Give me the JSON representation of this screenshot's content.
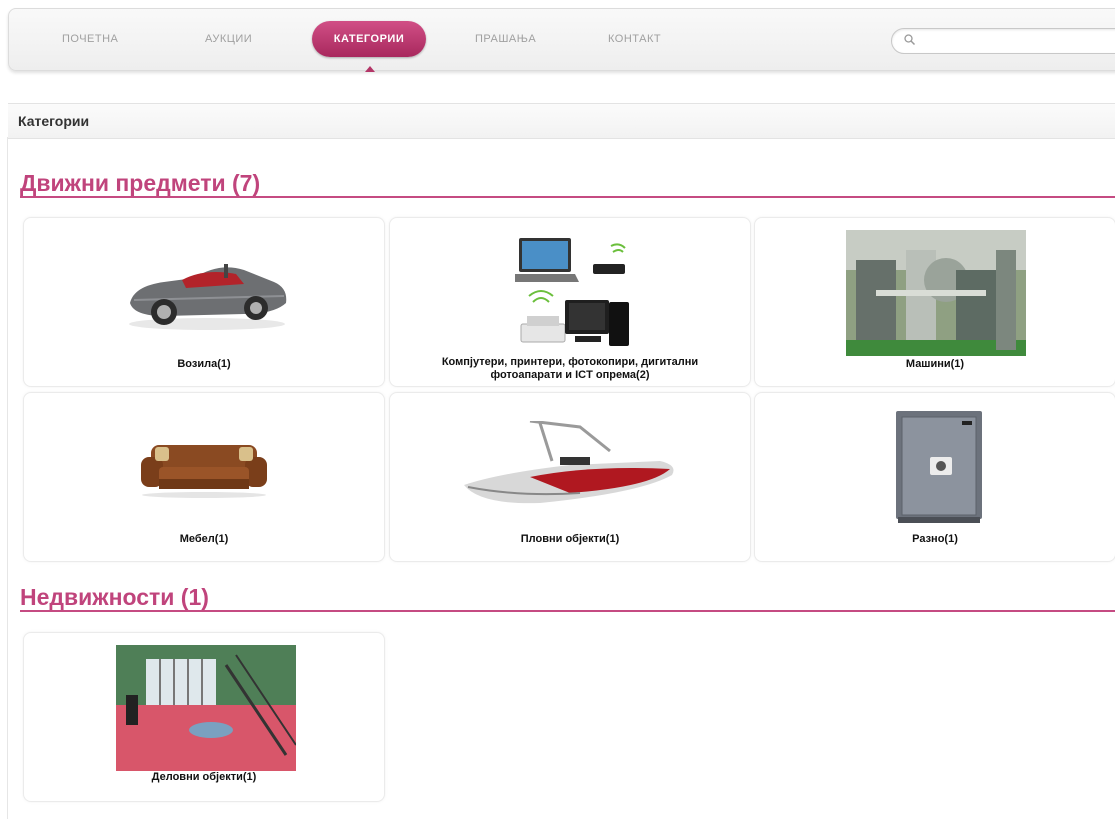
{
  "nav": {
    "items": [
      "ПОЧЕТНА",
      "АУКЦИИ",
      "КАТЕГОРИИ",
      "ПРАШАЊА",
      "КОНТАКТ"
    ],
    "active": "КАТЕГОРИИ",
    "search_placeholder": ""
  },
  "breadcrumb": {
    "title": "Категории"
  },
  "sections": [
    {
      "title": "Движни предмети (7)",
      "cards": [
        {
          "label": "Возила(1)",
          "icon": "car-image"
        },
        {
          "label": "Компјутери, принтери, фотокопири, дигитални фотоапарати и ICT опрема(2)",
          "icon": "computers-image"
        },
        {
          "label": "Машини(1)",
          "icon": "machines-image"
        },
        {
          "label": "Мебел(1)",
          "icon": "sofa-image"
        },
        {
          "label": "Пловни објекти(1)",
          "icon": "boat-image"
        },
        {
          "label": "Разно(1)",
          "icon": "safe-image"
        }
      ]
    },
    {
      "title": "Недвижности (1)",
      "cards": [
        {
          "label": "Деловни објекти(1)",
          "icon": "business-premises-image"
        }
      ]
    }
  ],
  "colors": {
    "accent": "#c0447c",
    "active_pill": "#b33567"
  }
}
